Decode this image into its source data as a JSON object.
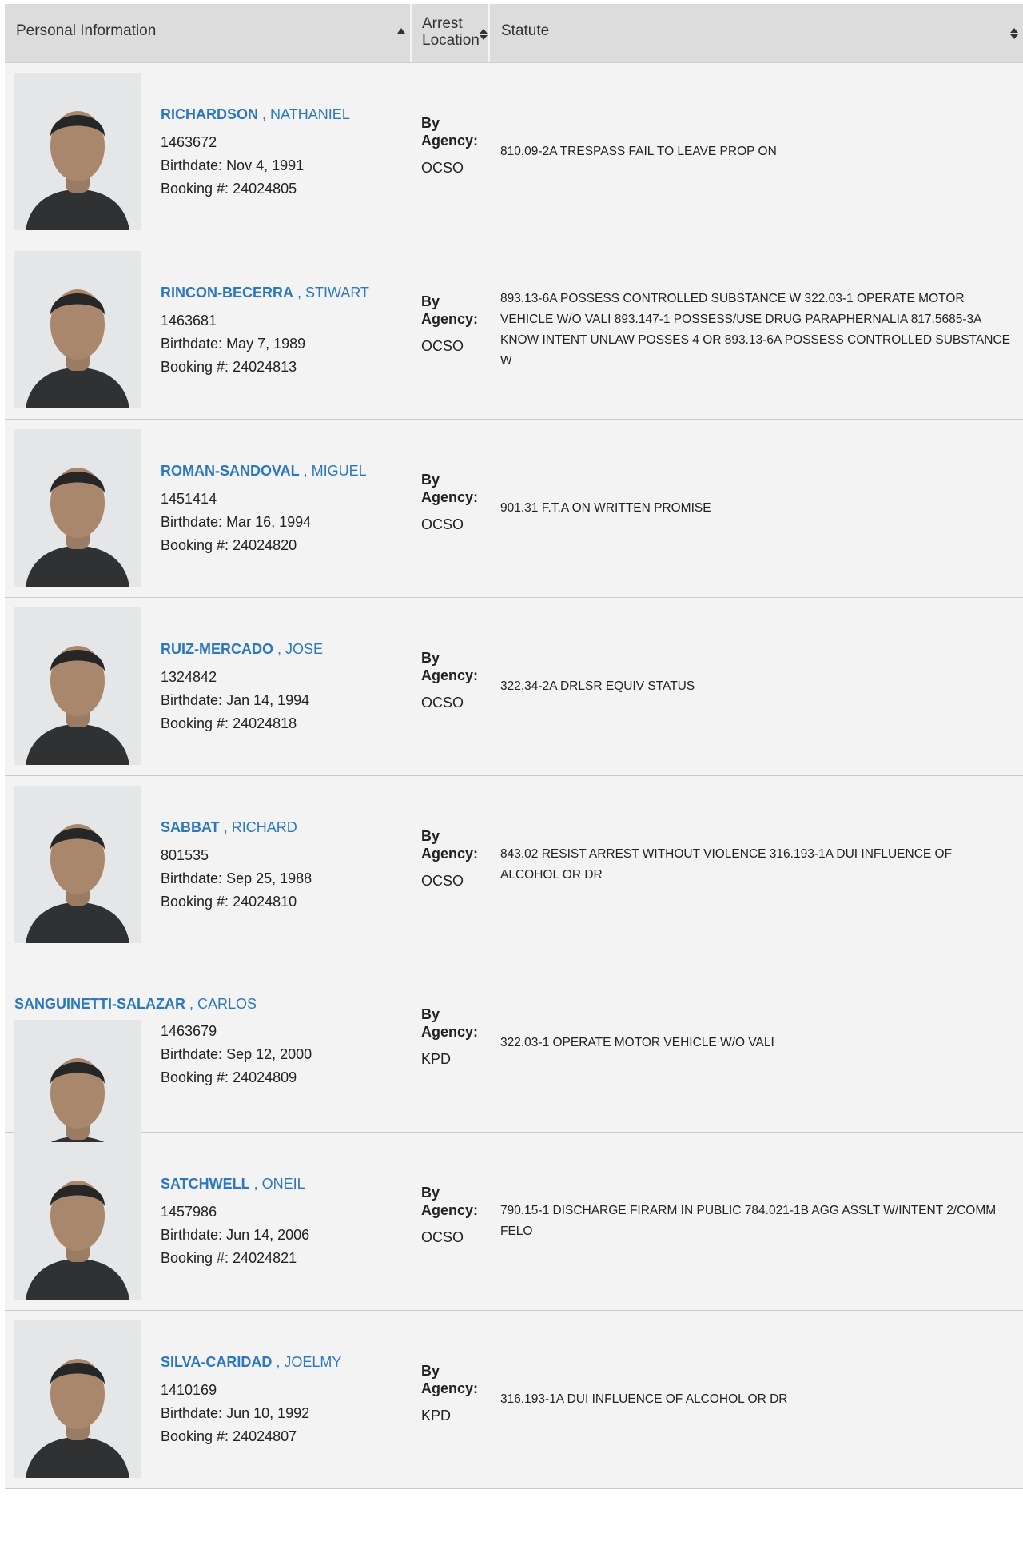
{
  "header": {
    "personal": "Personal Information",
    "arrest_line1": "Arrest",
    "arrest_line2": "Location",
    "statute": "Statute"
  },
  "by_label": "By",
  "agency_label": "Agency:",
  "birth_label": "Birthdate:",
  "booking_label": "Booking #:",
  "colors": {
    "link": "#2d77bd",
    "row_bg": "#f3f3f3",
    "header_bg": "#dcdcdc"
  },
  "rows": [
    {
      "last": "RICHARDSON",
      "first": ", NATHANIEL",
      "id": "1463672",
      "birthdate": "Nov 4, 1991",
      "booking": "24024805",
      "agency": "OCSO",
      "statute": "810.09-2A TRESPASS FAIL TO LEAVE PROP ON"
    },
    {
      "last": "RINCON-BECERRA",
      "first": ", STIWART",
      "id": "1463681",
      "birthdate": "May 7, 1989",
      "booking": "24024813",
      "agency": "OCSO",
      "statute": "893.13-6A POSSESS CONTROLLED SUBSTANCE W 322.03-1 OPERATE MOTOR VEHICLE W/O VALI 893.147-1 POSSESS/USE DRUG PARAPHERNALIA 817.5685-3A KNOW INTENT UNLAW POSSES 4 OR 893.13-6A POSSESS CONTROLLED SUBSTANCE W"
    },
    {
      "last": "ROMAN-SANDOVAL",
      "first": ", MIGUEL",
      "id": "1451414",
      "birthdate": "Mar 16, 1994",
      "booking": "24024820",
      "agency": "OCSO",
      "statute": "901.31 F.T.A ON WRITTEN PROMISE"
    },
    {
      "last": "RUIZ-MERCADO",
      "first": ", JOSE",
      "id": "1324842",
      "birthdate": "Jan 14, 1994",
      "booking": "24024818",
      "agency": "OCSO",
      "statute": "322.34-2A DRLSR EQUIV STATUS"
    },
    {
      "last": "SABBAT",
      "first": ", RICHARD",
      "id": "801535",
      "birthdate": "Sep 25, 1988",
      "booking": "24024810",
      "agency": "OCSO",
      "statute": "843.02 RESIST ARREST WITHOUT VIOLENCE 316.193-1A DUI INFLUENCE OF ALCOHOL OR DR"
    },
    {
      "last": "SANGUINETTI-SALAZAR",
      "first": ", CARLOS",
      "id": "1463679",
      "birthdate": "Sep 12, 2000",
      "booking": "24024809",
      "agency": "KPD",
      "statute": "322.03-1 OPERATE MOTOR VEHICLE W/O VALI"
    },
    {
      "last": "SATCHWELL",
      "first": ", ONEIL",
      "id": "1457986",
      "birthdate": "Jun 14, 2006",
      "booking": "24024821",
      "agency": "OCSO",
      "statute": "790.15-1 DISCHARGE FIRARM IN PUBLIC 784.021-1B AGG ASSLT W/INTENT 2/COMM FELO"
    },
    {
      "last": "SILVA-CARIDAD",
      "first": ", JOELMY",
      "id": "1410169",
      "birthdate": "Jun 10, 1992",
      "booking": "24024807",
      "agency": "KPD",
      "statute": "316.193-1A DUI INFLUENCE OF ALCOHOL OR DR"
    }
  ]
}
